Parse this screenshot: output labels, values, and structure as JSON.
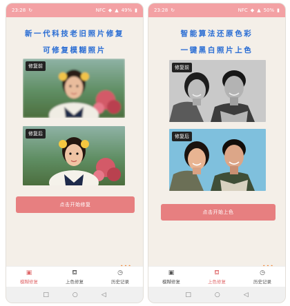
{
  "left": {
    "status": {
      "time": "23:28",
      "net": "NFC",
      "battery": "49%"
    },
    "headline_1": "新一代科技老旧照片修复",
    "headline_2": "可修复模糊照片",
    "before_label": "修复前",
    "after_label": "修复后",
    "cta_label": "点击开始修复",
    "dots": "•••",
    "tabs": [
      {
        "label": "模糊修复",
        "icon": "image-icon",
        "active": true
      },
      {
        "label": "上色修复",
        "icon": "paint-bucket-icon",
        "active": false
      },
      {
        "label": "历史记录",
        "icon": "clock-icon",
        "active": false
      }
    ]
  },
  "right": {
    "status": {
      "time": "23:28",
      "net": "NFC",
      "battery": "50%"
    },
    "headline_1": "智能算法还原色彩",
    "headline_2": "一键黑白照片上色",
    "before_label": "修复前",
    "after_label": "修复后",
    "cta_label": "点击开始上色",
    "dots": "•••",
    "tabs": [
      {
        "label": "模糊修复",
        "icon": "image-icon",
        "active": false
      },
      {
        "label": "上色修复",
        "icon": "paint-bucket-icon",
        "active": true
      },
      {
        "label": "历史记录",
        "icon": "clock-icon",
        "active": false
      }
    ]
  },
  "colors": {
    "accent": "#e77f80",
    "status_bar": "#f3a1a4",
    "headline": "#2f6fd1",
    "background": "#f4efe8"
  }
}
